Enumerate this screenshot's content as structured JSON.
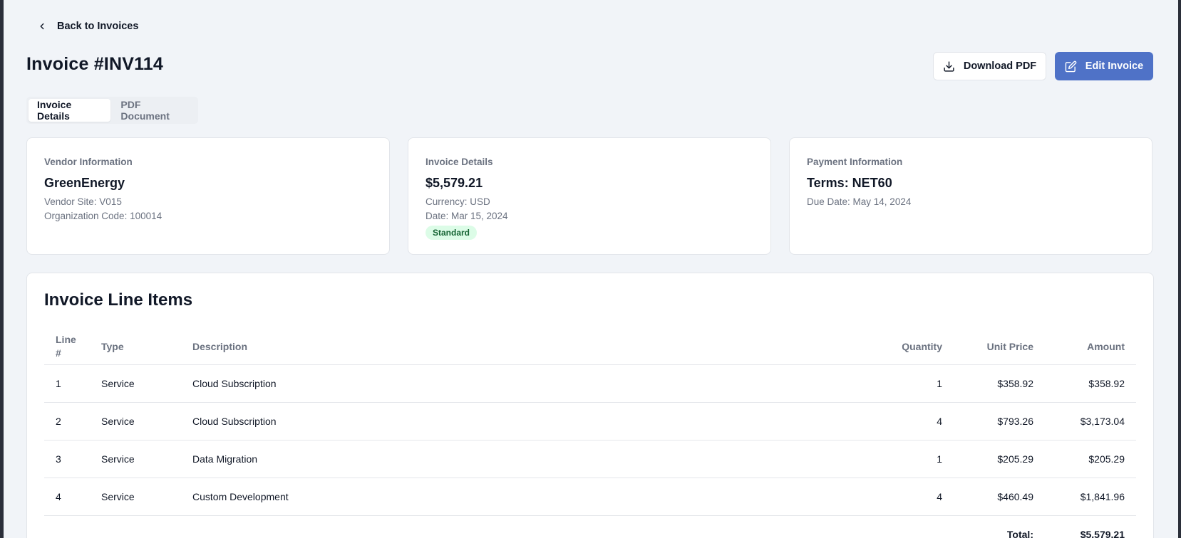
{
  "nav": {
    "back_label": "Back to Invoices"
  },
  "header": {
    "title": "Invoice #INV114",
    "download_label": "Download PDF",
    "edit_label": "Edit Invoice"
  },
  "tabs": [
    {
      "label": "Invoice Details",
      "active": true
    },
    {
      "label": "PDF Document",
      "active": false
    }
  ],
  "vendor": {
    "label": "Vendor Information",
    "name": "GreenEnergy",
    "site": "Vendor Site: V015",
    "org_code": "Organization Code: 100014"
  },
  "invoice": {
    "label": "Invoice Details",
    "amount": "$5,579.21",
    "currency": "Currency: USD",
    "date": "Date: Mar 15, 2024",
    "type_badge": "Standard"
  },
  "payment": {
    "label": "Payment Information",
    "terms": "Terms: NET60",
    "due_date": "Due Date: May 14, 2024"
  },
  "line_items": {
    "title": "Invoice Line Items",
    "columns": {
      "line_a": "Line",
      "line_b": "#",
      "type": "Type",
      "description": "Description",
      "quantity": "Quantity",
      "unit_price": "Unit Price",
      "amount": "Amount"
    },
    "rows": [
      {
        "line": "1",
        "type": "Service",
        "description": "Cloud Subscription",
        "quantity": "1",
        "unit_price": "$358.92",
        "amount": "$358.92"
      },
      {
        "line": "2",
        "type": "Service",
        "description": "Cloud Subscription",
        "quantity": "4",
        "unit_price": "$793.26",
        "amount": "$3,173.04"
      },
      {
        "line": "3",
        "type": "Service",
        "description": "Data Migration",
        "quantity": "1",
        "unit_price": "$205.29",
        "amount": "$205.29"
      },
      {
        "line": "4",
        "type": "Service",
        "description": "Custom Development",
        "quantity": "4",
        "unit_price": "$460.49",
        "amount": "$1,841.96"
      }
    ],
    "total_label": "Total:",
    "total_value": "$5,579.21"
  },
  "colors": {
    "primary": "#4f72c7",
    "badge_bg": "#dcfce7",
    "badge_text": "#166534",
    "background": "#f1f4f8"
  },
  "icons": {
    "back": "chevron-left-icon",
    "download": "download-icon",
    "edit": "edit-icon"
  }
}
